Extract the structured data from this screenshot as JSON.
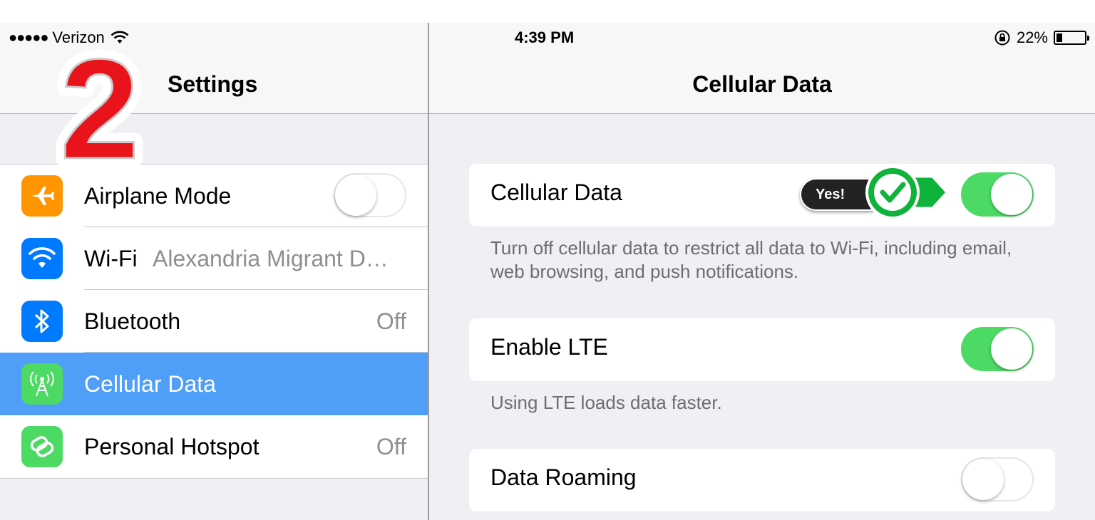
{
  "status_bar": {
    "signal_dots": "●●●●●",
    "carrier": "Verizon",
    "time": "4:39 PM",
    "battery_percent": "22%",
    "battery_level": 0.22
  },
  "badge": {
    "number": "2"
  },
  "left_pane": {
    "title": "Settings",
    "items": [
      {
        "label": "Airplane Mode",
        "icon": "airplane-icon",
        "icon_color": "#ff9500",
        "toggle": "off"
      },
      {
        "label": "Wi-Fi",
        "icon": "wifi-icon",
        "icon_color": "#007aff",
        "value": "Alexandria Migrant D…"
      },
      {
        "label": "Bluetooth",
        "icon": "bluetooth-icon",
        "icon_color": "#007aff",
        "value": "Off"
      },
      {
        "label": "Cellular Data",
        "icon": "antenna-icon",
        "icon_color": "#4cd964",
        "selected": true
      },
      {
        "label": "Personal Hotspot",
        "icon": "hotspot-icon",
        "icon_color": "#4cd964",
        "value": "Off"
      }
    ]
  },
  "right_pane": {
    "title": "Cellular Data",
    "settings": [
      {
        "label": "Cellular Data",
        "toggle": "on",
        "footnote": "Turn off cellular data to restrict all data to Wi-Fi, including email, web browsing, and push notifications."
      },
      {
        "label": "Enable LTE",
        "toggle": "on",
        "footnote": "Using LTE loads data faster."
      },
      {
        "label": "Data Roaming",
        "toggle": "off"
      }
    ]
  },
  "annotation": {
    "label": "Yes!",
    "accent_color": "#0fb23a"
  },
  "colors": {
    "selected_row": "#4f9ff8",
    "toggle_on": "#4cd964",
    "badge_red": "#e8131b"
  }
}
